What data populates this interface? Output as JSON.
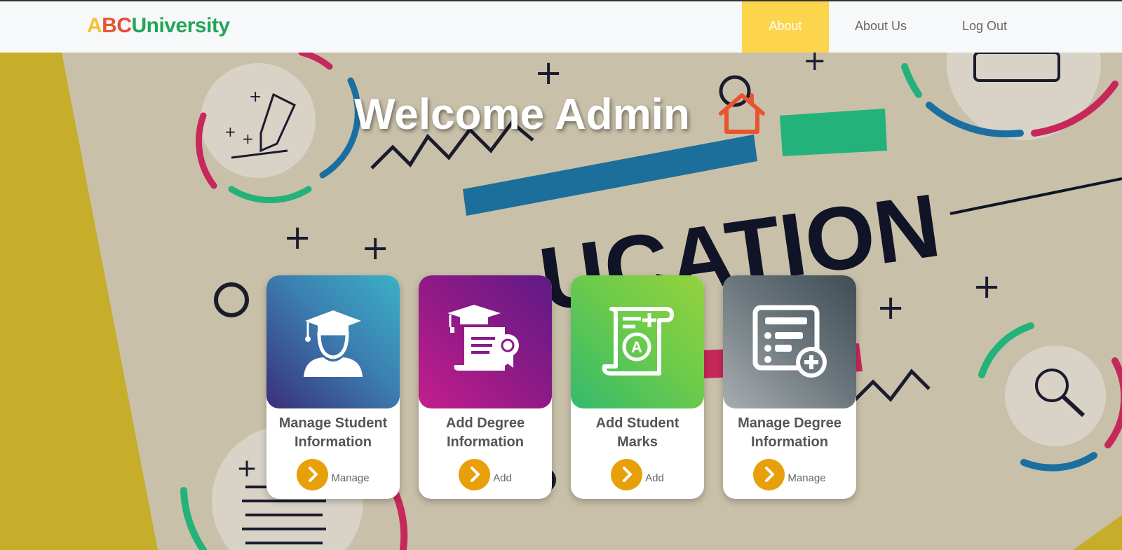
{
  "brand": {
    "a": "A",
    "b": "B",
    "c": "C",
    "rest": "University"
  },
  "nav": [
    {
      "label": "About"
    },
    {
      "label": "About Us"
    },
    {
      "label": "Log Out"
    }
  ],
  "hero": {
    "title": "Welcome Admin"
  },
  "background_text": "UCATION",
  "cards": [
    {
      "title_line1": "Manage Student",
      "title_line2": "Information",
      "action": "Manage",
      "icon": "student-graduate-icon"
    },
    {
      "title_line1": "Add Degree",
      "title_line2": "Information",
      "action": "Add",
      "icon": "degree-certificate-icon"
    },
    {
      "title_line1": "Add Student",
      "title_line2": "Marks",
      "action": "Add",
      "icon": "grade-scroll-icon"
    },
    {
      "title_line1": "Manage Degree",
      "title_line2": "Information",
      "action": "Manage",
      "icon": "list-add-icon"
    }
  ],
  "colors": {
    "accent": "#fdd54d",
    "button": "#e7a009",
    "brand_green": "#23a55a"
  }
}
